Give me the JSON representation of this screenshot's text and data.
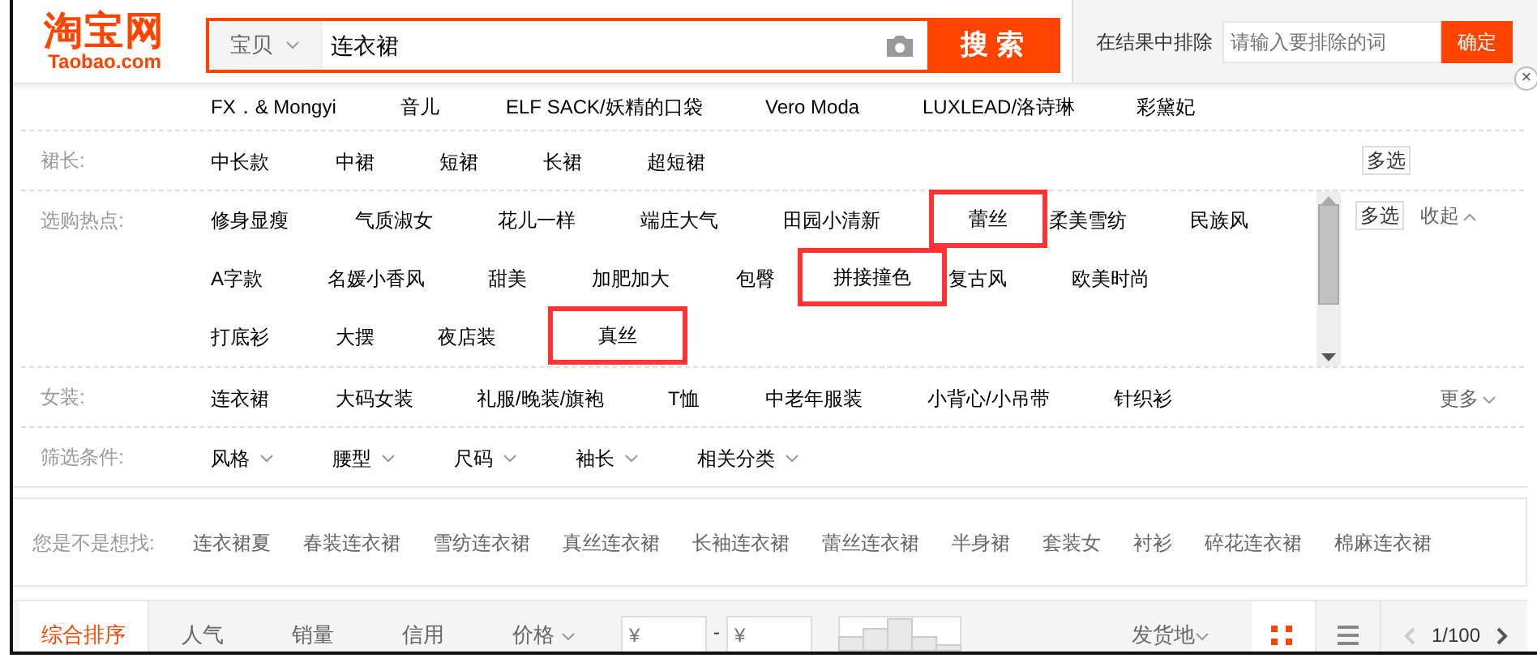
{
  "logo": {
    "name": "淘宝网",
    "domain": "Taobao.com"
  },
  "search": {
    "scope": "宝贝",
    "value": "连衣裙",
    "button": "搜 索"
  },
  "exclude": {
    "label": "在结果中排除",
    "placeholder": "请输入要排除的词",
    "button": "确定"
  },
  "close": "×",
  "filters": [
    {
      "kind": "brands",
      "items": [
        {
          "text": "FX．& Mongyi",
          "highlighted": false
        },
        {
          "text": "音儿",
          "highlighted": false
        },
        {
          "text": "ELF SACK/妖精的口袋",
          "highlighted": false
        },
        {
          "text": "Vero Moda",
          "highlighted": false
        },
        {
          "text": "LUXLEAD/洛诗琳",
          "highlighted": false
        },
        {
          "text": "彩黛妃",
          "highlighted": false
        }
      ]
    },
    {
      "kind": "options",
      "label": "裙长:",
      "multi": "多选",
      "items": [
        {
          "text": "中长款",
          "highlighted": false
        },
        {
          "text": "中裙",
          "highlighted": false
        },
        {
          "text": "短裙",
          "highlighted": false
        },
        {
          "text": "长裙",
          "highlighted": false
        },
        {
          "text": "超短裙",
          "highlighted": false
        }
      ]
    },
    {
      "kind": "scroll",
      "label": "选购热点:",
      "multi": "多选",
      "toggle": "收起",
      "items": [
        {
          "text": "修身显瘦",
          "highlighted": false
        },
        {
          "text": "气质淑女",
          "highlighted": false
        },
        {
          "text": "花儿一样",
          "highlighted": false
        },
        {
          "text": "端庄大气",
          "highlighted": false
        },
        {
          "text": "田园小清新",
          "highlighted": false
        },
        {
          "text": "蕾丝",
          "highlighted": true
        },
        {
          "text": "柔美雪纺",
          "highlighted": false
        },
        {
          "text": "民族风",
          "highlighted": false
        },
        {
          "text": "A字款",
          "highlighted": false
        },
        {
          "text": "名媛小香风",
          "highlighted": false
        },
        {
          "text": "甜美",
          "highlighted": false
        },
        {
          "text": "加肥加大",
          "highlighted": false
        },
        {
          "text": "包臀",
          "highlighted": false
        },
        {
          "text": "拼接撞色",
          "highlighted": true
        },
        {
          "text": "复古风",
          "highlighted": false
        },
        {
          "text": "欧美时尚",
          "highlighted": false
        },
        {
          "text": "打底衫",
          "highlighted": false
        },
        {
          "text": "大摆",
          "highlighted": false
        },
        {
          "text": "夜店装",
          "highlighted": false
        },
        {
          "text": "真丝",
          "highlighted": true
        }
      ]
    },
    {
      "kind": "options",
      "label": "女装:",
      "toggle": "更多",
      "items": [
        {
          "text": "连衣裙",
          "highlighted": false
        },
        {
          "text": "大码女装",
          "highlighted": false
        },
        {
          "text": "礼服/晚装/旗袍",
          "highlighted": false
        },
        {
          "text": "T恤",
          "highlighted": false
        },
        {
          "text": "中老年服装",
          "highlighted": false
        },
        {
          "text": "小背心/小吊带",
          "highlighted": false
        },
        {
          "text": "针织衫",
          "highlighted": false
        }
      ]
    },
    {
      "kind": "dropdowns",
      "label": "筛选条件:",
      "items": [
        {
          "text": "风格",
          "highlighted": false
        },
        {
          "text": "腰型",
          "highlighted": false
        },
        {
          "text": "尺码",
          "highlighted": false
        },
        {
          "text": "袖长",
          "highlighted": false
        },
        {
          "text": "相关分类",
          "highlighted": false
        }
      ]
    }
  ],
  "suggest": {
    "label": "您是不是想找:",
    "items": [
      "连衣裙夏",
      "春装连衣裙",
      "雪纺连衣裙",
      "真丝连衣裙",
      "长袖连衣裙",
      "蕾丝连衣裙",
      "半身裙",
      "套装女",
      "衬衫",
      "碎花连衣裙",
      "棉麻连衣裙"
    ]
  },
  "sort": {
    "tabs": [
      {
        "label": "综合排序",
        "selected": true,
        "dropdown": false
      },
      {
        "label": "人气",
        "selected": false,
        "dropdown": false
      },
      {
        "label": "销量",
        "selected": false,
        "dropdown": false
      },
      {
        "label": "信用",
        "selected": false,
        "dropdown": false
      },
      {
        "label": "价格",
        "selected": false,
        "dropdown": true
      }
    ],
    "price_min": {
      "placeholder": "¥"
    },
    "price_sep": "-",
    "price_max": {
      "placeholder": "¥"
    },
    "location": "发货地",
    "views": [
      {
        "kind": "grid",
        "selected": true
      },
      {
        "kind": "list",
        "selected": false
      }
    ],
    "page": "1/100"
  }
}
